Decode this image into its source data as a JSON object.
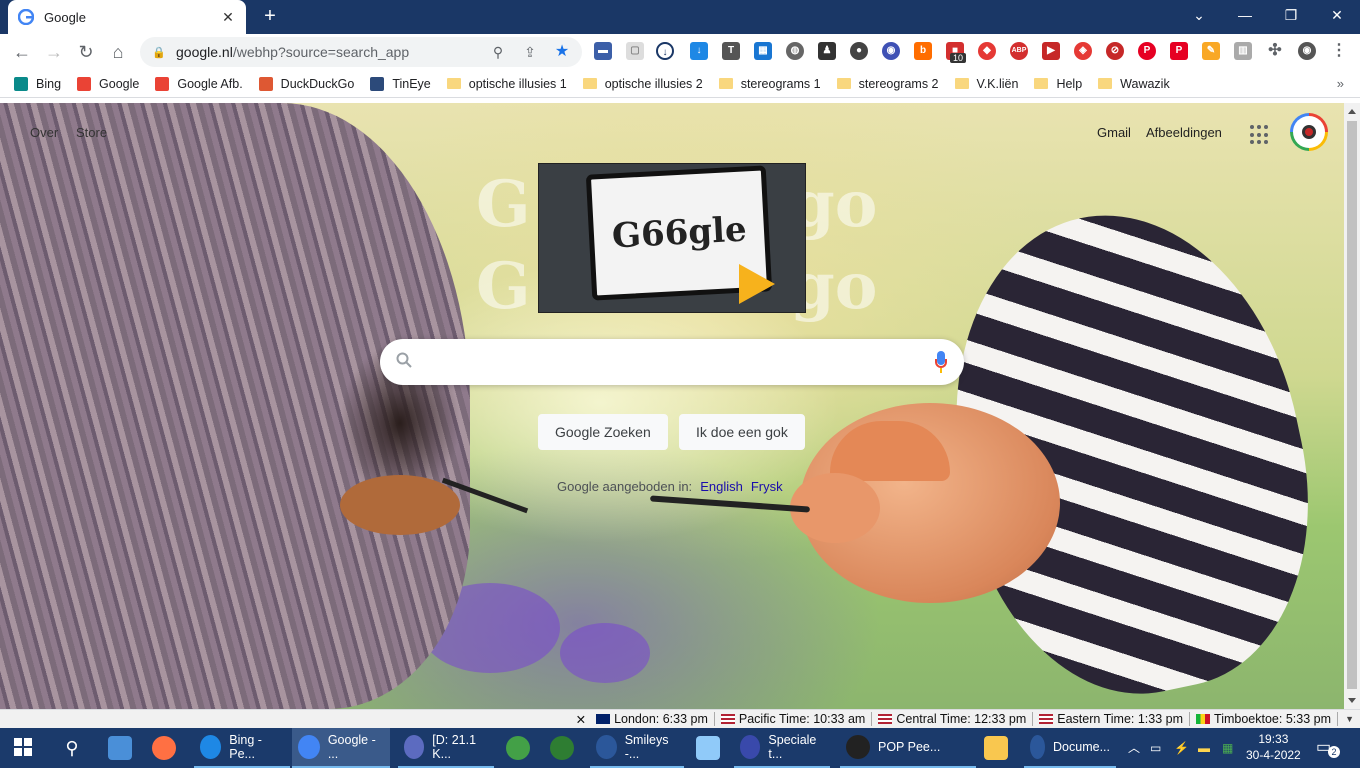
{
  "tab": {
    "title": "Google",
    "close": "✕",
    "new": "+"
  },
  "window": {
    "minimize": "—",
    "maximize": "❐",
    "close": "✕",
    "tabsearch": "⌄"
  },
  "toolbar": {
    "url_domain": "google.nl",
    "url_path": "/webhp?source=search_app"
  },
  "bookmarks": [
    {
      "label": "Bing",
      "color": "#0a8a8a"
    },
    {
      "label": "Google",
      "color": "#ea4335"
    },
    {
      "label": "Google Afb.",
      "color": "#ea4335"
    },
    {
      "label": "DuckDuckGo",
      "color": "#de5833"
    },
    {
      "label": "TinEye",
      "color": "#2c4a7a"
    },
    {
      "label": "optische illusies  1",
      "folder": true
    },
    {
      "label": "optische illusies 2",
      "folder": true
    },
    {
      "label": "stereograms 1",
      "folder": true
    },
    {
      "label": "stereograms 2",
      "folder": true
    },
    {
      "label": "V.K.liën",
      "folder": true
    },
    {
      "label": "Help",
      "folder": true
    },
    {
      "label": "Wawazik",
      "folder": true
    }
  ],
  "bookmarks_more": "»",
  "extensions_badge": "10",
  "page": {
    "top_left": [
      "Over",
      "Store"
    ],
    "gmail": "Gmail",
    "images": "Afbeeldingen",
    "doodle_text": "G66gle",
    "ghost_letters": [
      "G",
      "G",
      "go",
      "go"
    ],
    "search_placeholder": "",
    "btn_search": "Google Zoeken",
    "btn_lucky": "Ik doe een gok",
    "offered_in": "Google aangeboden in:",
    "languages": [
      "English",
      "Frysk"
    ]
  },
  "clocks": [
    {
      "label": "London: 6:33 pm",
      "flag": "uk"
    },
    {
      "label": "Pacific Time: 10:33 am",
      "flag": "us"
    },
    {
      "label": "Central Time: 12:33 pm",
      "flag": "us"
    },
    {
      "label": "Eastern Time: 1:33 pm",
      "flag": "us"
    },
    {
      "label": "Timboektoe: 5:33 pm",
      "flag": "ml"
    }
  ],
  "clock_close": "✕",
  "taskbar": {
    "items": [
      {
        "label": "Bing - Pe...",
        "color": "#1e88e5"
      },
      {
        "label": "Google - ...",
        "color": "#4285f4",
        "active": true
      },
      {
        "label": "[D: 21.1 K...",
        "color": "#5c6bc0"
      },
      {
        "label": "Smileys -...",
        "color": "#2b579a"
      },
      {
        "label": "Speciale t...",
        "color": "#3949ab"
      },
      {
        "label": "POP Pee...",
        "color": "#222"
      },
      {
        "label": "Docume...",
        "color": "#2b579a"
      }
    ],
    "time": "19:33",
    "date": "30-4-2022",
    "notifications": "2"
  }
}
